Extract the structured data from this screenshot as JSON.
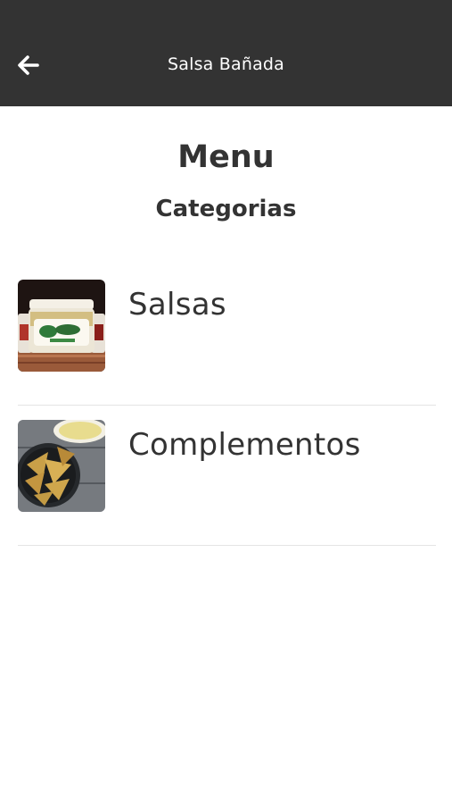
{
  "header": {
    "back_icon": "arrow-left-icon",
    "title": "Salsa Bañada"
  },
  "page": {
    "title": "Menu",
    "subtitle": "Categorias"
  },
  "categories": [
    {
      "label": "Salsas",
      "image": "salsa-jars-photo"
    },
    {
      "label": "Complementos",
      "image": "tortilla-chips-photo"
    }
  ],
  "colors": {
    "header_bg": "#333333",
    "header_text": "#ffffff",
    "text": "#333333",
    "divider": "#e4e4e4",
    "background": "#ffffff"
  }
}
